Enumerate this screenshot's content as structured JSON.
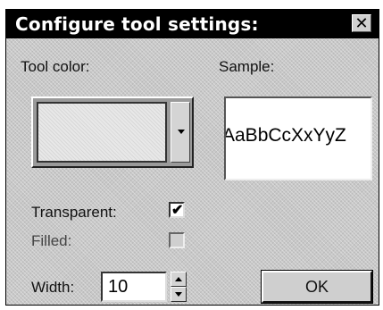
{
  "window": {
    "title": "Configure tool settings:",
    "close_glyph": "✕"
  },
  "tool_color": {
    "label": "Tool color:",
    "swatch_color": "#e8e8e8",
    "dropdown_icon": "chevron-down-icon"
  },
  "sample": {
    "label": "Sample:",
    "text": "AaBbCcXxYyZ"
  },
  "transparent": {
    "label": "Transparent:",
    "checked": true,
    "check_glyph": "✔"
  },
  "filled": {
    "label": "Filled:",
    "checked": false,
    "enabled": false
  },
  "width": {
    "label": "Width:",
    "value": "10"
  },
  "buttons": {
    "ok_label": "OK"
  }
}
